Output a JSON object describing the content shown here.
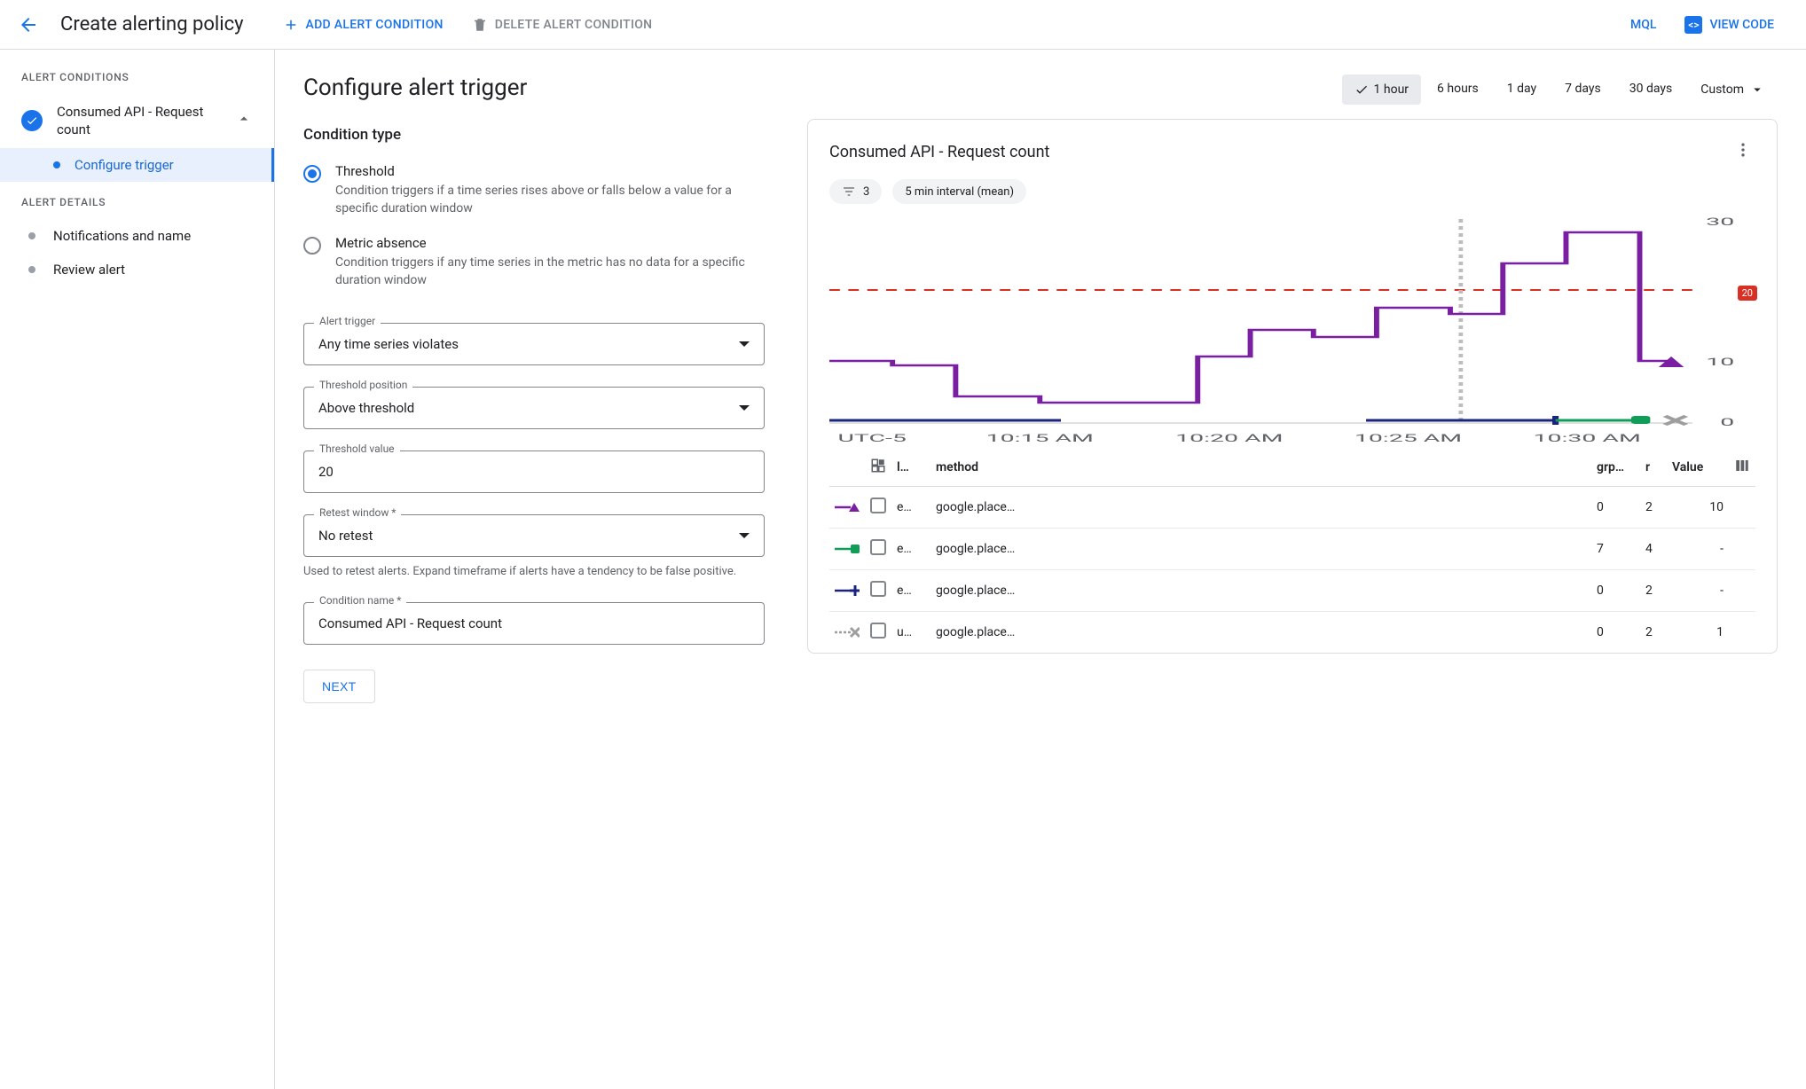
{
  "topbar": {
    "title": "Create alerting policy",
    "add_condition": "ADD ALERT CONDITION",
    "delete_condition": "DELETE ALERT CONDITION",
    "mql": "MQL",
    "view_code": "VIEW CODE"
  },
  "sidebar": {
    "section_conditions": "ALERT CONDITIONS",
    "condition_name": "Consumed API - Request count",
    "configure_trigger": "Configure trigger",
    "section_details": "ALERT DETAILS",
    "notifications": "Notifications and name",
    "review": "Review alert"
  },
  "form": {
    "heading": "Configure alert trigger",
    "cond_type_heading": "Condition type",
    "threshold_title": "Threshold",
    "threshold_desc": "Condition triggers if a time series rises above or falls below a value for a specific duration window",
    "absence_title": "Metric absence",
    "absence_desc": "Condition triggers if any time series in the metric has no data for a specific duration window",
    "alert_trigger_label": "Alert trigger",
    "alert_trigger_value": "Any time series violates",
    "threshold_position_label": "Threshold position",
    "threshold_position_value": "Above threshold",
    "threshold_value_label": "Threshold value",
    "threshold_value_value": "20",
    "retest_label": "Retest window *",
    "retest_value": "No retest",
    "retest_helper": "Used to retest alerts. Expand timeframe if alerts have a tendency to be false positive.",
    "condition_name_label": "Condition name *",
    "condition_name_value": "Consumed API - Request count",
    "next": "NEXT"
  },
  "ranges": {
    "r1h": "1 hour",
    "r6h": "6 hours",
    "r1d": "1 day",
    "r7d": "7 days",
    "r30d": "30 days",
    "custom": "Custom"
  },
  "card": {
    "title": "Consumed API - Request count",
    "filter_count": "3",
    "interval": "5 min interval (mean)",
    "threshold_badge": "20",
    "timezone": "UTC-5",
    "x_ticks": [
      "10:15 AM",
      "10:20 AM",
      "10:25 AM",
      "10:30 AM"
    ],
    "y_ticks": [
      "30",
      "20",
      "10",
      "0"
    ]
  },
  "chart_data": {
    "type": "line",
    "xlabel": "",
    "ylabel": "",
    "ylim": [
      0,
      30
    ],
    "threshold": 20,
    "x_ticks": [
      "10:15 AM",
      "10:20 AM",
      "10:25 AM",
      "10:30 AM"
    ],
    "series": [
      {
        "name": "google.place… (purple)",
        "color": "#7b1fa2",
        "marker": "triangle",
        "values": [
          10,
          10,
          9,
          9,
          4,
          4,
          3,
          3,
          3,
          3,
          10,
          10,
          14,
          14,
          13,
          13,
          17,
          17,
          16,
          16,
          24,
          24,
          28,
          28,
          10
        ]
      },
      {
        "name": "google.place… (blue)",
        "color": "#1a237e",
        "marker": "plus",
        "values": [
          0,
          0,
          0,
          0,
          0,
          0,
          0,
          0,
          null,
          null,
          null,
          null,
          null,
          null,
          0,
          0,
          0,
          0,
          null
        ]
      },
      {
        "name": "google.place… (green)",
        "color": "#0f9d58",
        "marker": "square",
        "values": [
          null,
          null,
          null,
          null,
          null,
          null,
          null,
          null,
          null,
          null,
          null,
          null,
          null,
          null,
          null,
          null,
          null,
          null,
          0,
          0,
          0
        ]
      },
      {
        "name": "google.place… (grey)",
        "color": "#9e9e9e",
        "marker": "x",
        "values": [
          null,
          null,
          null,
          null,
          null,
          null,
          null,
          null,
          null,
          null,
          null,
          null,
          null,
          null,
          null,
          null,
          null,
          null,
          null,
          null,
          null,
          null,
          0,
          0
        ]
      }
    ]
  },
  "table": {
    "headers": {
      "legend": "",
      "cb": "",
      "l": "l…",
      "method": "method",
      "grp": "grp…",
      "r": "r",
      "value": "Value"
    },
    "rows": [
      {
        "marker": "triangle",
        "color": "#7b1fa2",
        "l": "e…",
        "method": "google.place…",
        "grp": "0",
        "r": "2",
        "value": "10"
      },
      {
        "marker": "square",
        "color": "#0f9d58",
        "l": "e…",
        "method": "google.place…",
        "grp": "7",
        "r": "4",
        "value": "-"
      },
      {
        "marker": "plus",
        "color": "#1a237e",
        "l": "e…",
        "method": "google.place…",
        "grp": "0",
        "r": "2",
        "value": "-"
      },
      {
        "marker": "x",
        "color": "#9e9e9e",
        "l": "u…",
        "method": "google.place…",
        "grp": "0",
        "r": "2",
        "value": "1"
      }
    ]
  }
}
